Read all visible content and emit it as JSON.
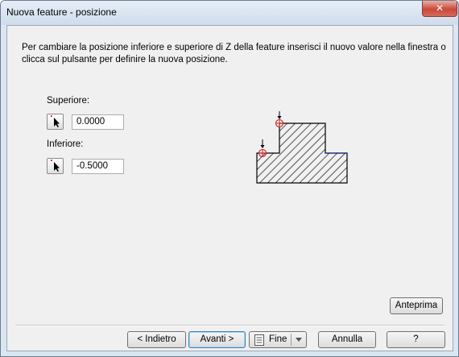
{
  "window": {
    "title": "Nuova feature - posizione",
    "close_glyph": "✕"
  },
  "description": "Per cambiare la posizione inferiore e superiore di Z della feature inserisci il nuovo valore nella finestra o clicca sul pulsante per definire la nuova posizione.",
  "superiore": {
    "label": "Superiore:",
    "value": "0.0000"
  },
  "inferiore": {
    "label": "Inferiore:",
    "value": "-0.5000"
  },
  "buttons": {
    "anteprima": "Anteprima",
    "indietro": "< Indietro",
    "avanti": "Avanti >",
    "fine": "Fine",
    "annulla": "Annulla",
    "help": "?"
  },
  "icons": {
    "pick": "cursor-pick-icon",
    "fine": "document-icon",
    "marker": "target-marker-icon"
  },
  "colors": {
    "hatch": "#000000",
    "marker": "#d02020",
    "accent_border": "#3c7fb1"
  }
}
